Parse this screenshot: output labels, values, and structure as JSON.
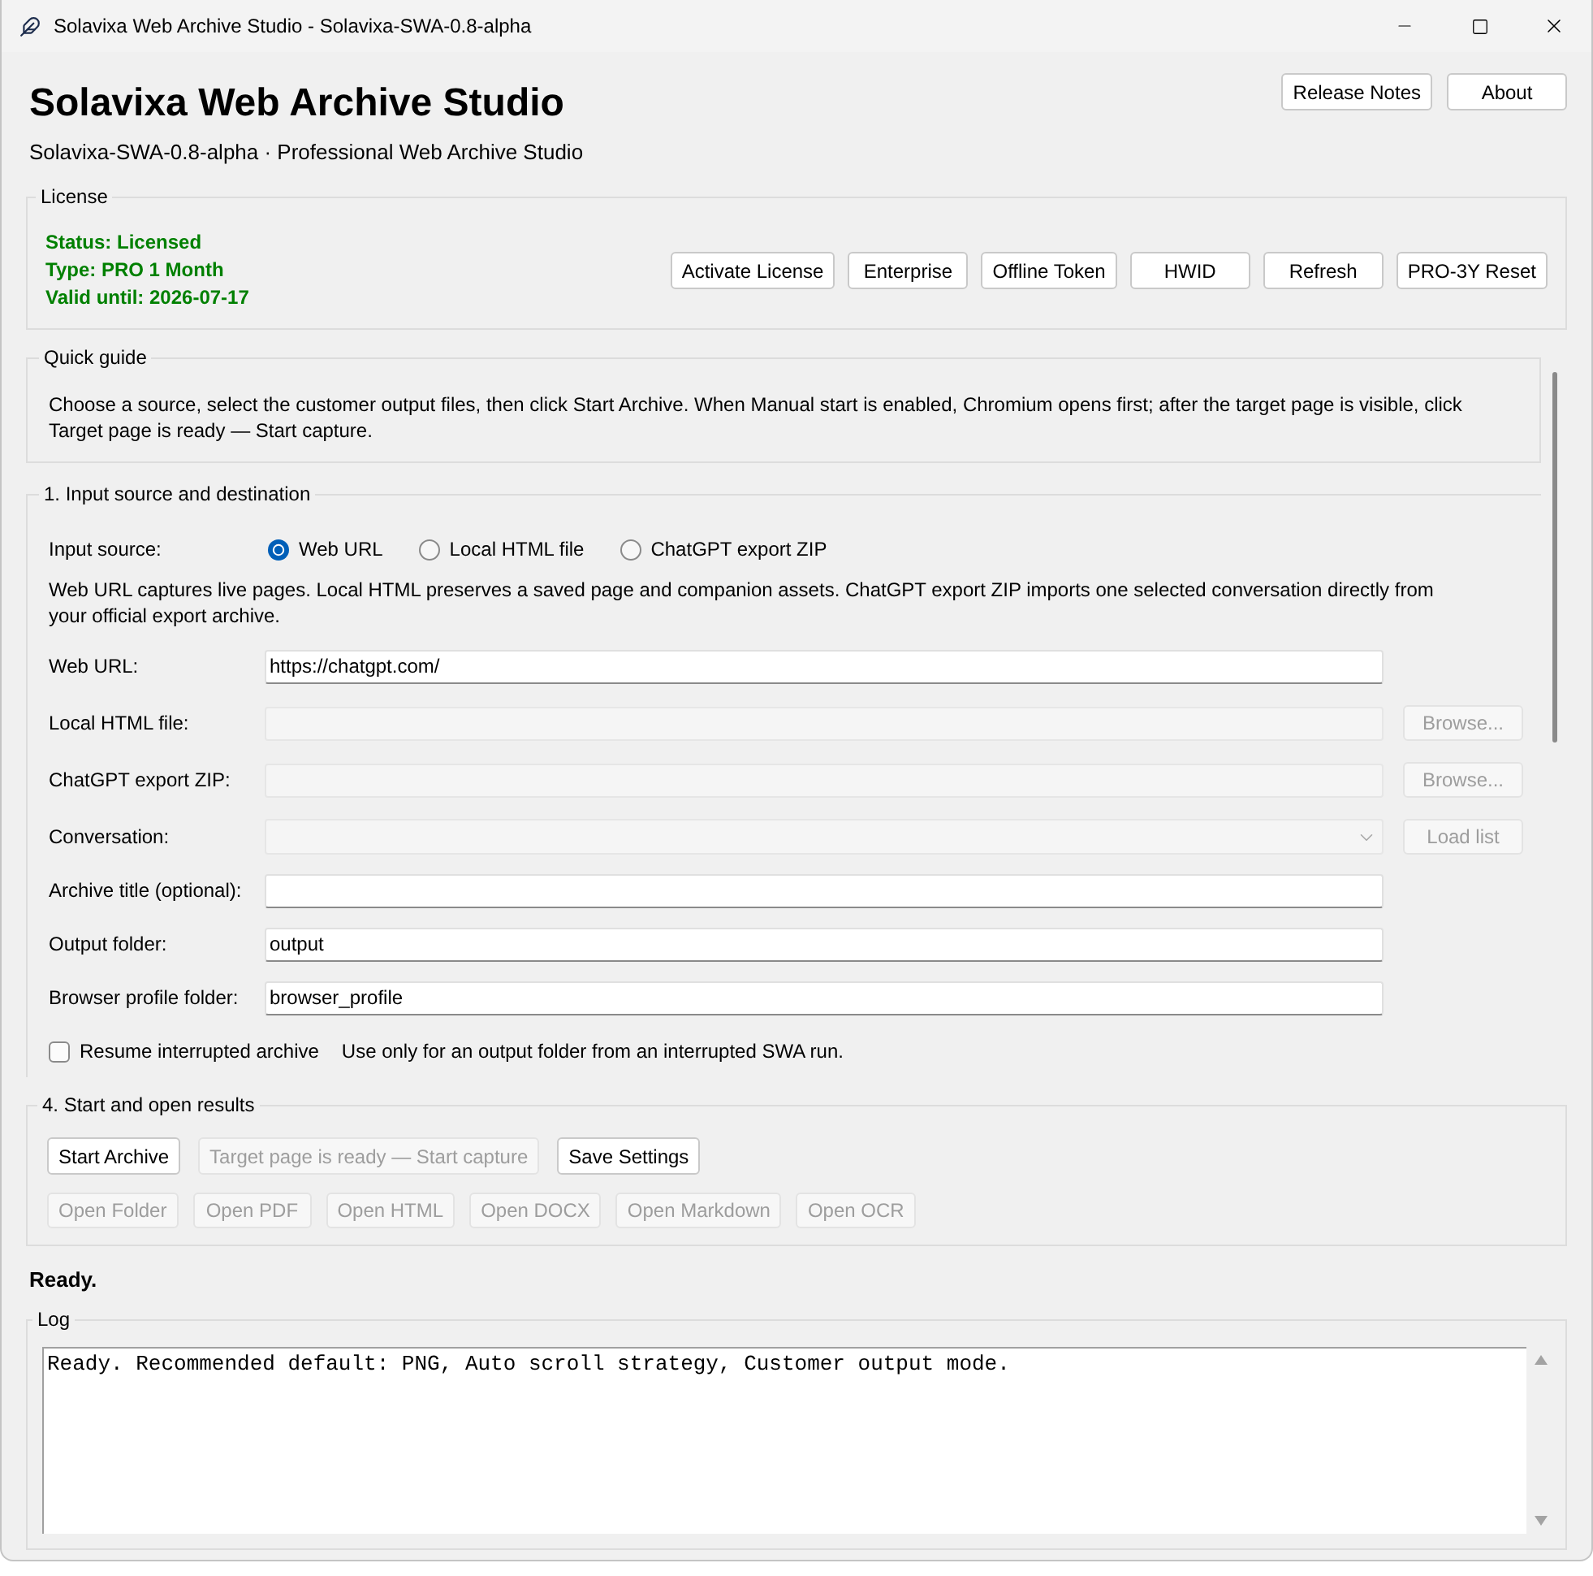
{
  "window": {
    "title": "Solavixa Web Archive Studio - Solavixa-SWA-0.8-alpha"
  },
  "header": {
    "title": "Solavixa Web Archive Studio",
    "subtitle": "Solavixa-SWA-0.8-alpha · Professional Web Archive Studio",
    "buttons": [
      "Release Notes",
      "About"
    ]
  },
  "license": {
    "label": "License",
    "status_lines": [
      "Status: Licensed",
      "Type: PRO 1 Month",
      "Valid until: 2026-07-17"
    ],
    "buttons": [
      "Activate License",
      "Enterprise",
      "Offline Token",
      "HWID",
      "Refresh",
      "PRO-3Y Reset"
    ]
  },
  "quick_guide": {
    "label": "Quick guide",
    "text": "Choose a source, select the customer output files, then click Start Archive. When Manual start is enabled, Chromium opens first; after the target page is visible, click Target page is ready — Start capture."
  },
  "input_section": {
    "label": "1. Input source and destination",
    "source_label": "Input source:",
    "sources": [
      {
        "label": "Web URL",
        "selected": true
      },
      {
        "label": "Local HTML file",
        "selected": false
      },
      {
        "label": "ChatGPT export ZIP",
        "selected": false
      }
    ],
    "description": "Web URL captures live pages. Local HTML preserves a saved page and companion assets. ChatGPT export ZIP imports one selected conversation directly from your official export archive.",
    "fields": [
      {
        "kind": "text",
        "label": "Web URL:",
        "value": "https://chatgpt.com/",
        "disabled": false
      },
      {
        "kind": "file",
        "label": "Local HTML file:",
        "disabled": true,
        "button": {
          "label": "Browse...",
          "disabled": true
        }
      },
      {
        "kind": "file",
        "label": "ChatGPT export ZIP:",
        "disabled": true,
        "button": {
          "label": "Browse...",
          "disabled": true
        }
      },
      {
        "kind": "combo",
        "label": "Conversation:",
        "disabled": true,
        "button": {
          "label": "Load list",
          "disabled": true
        }
      },
      {
        "kind": "text",
        "label": "Archive title (optional):",
        "disabled": false
      },
      {
        "kind": "text",
        "label": "Output folder:",
        "value": "output",
        "disabled": false
      },
      {
        "kind": "text",
        "label": "Browser profile folder:",
        "value": "browser_profile",
        "disabled": false
      }
    ],
    "resume": {
      "label": "Resume interrupted archive",
      "checked": false,
      "note": "Use only for an output folder from an interrupted SWA run."
    }
  },
  "start_section": {
    "label": "4. Start and open results",
    "actions": [
      {
        "label": "Start Archive",
        "disabled": false
      },
      {
        "label": "Target page is ready — Start capture",
        "disabled": true
      },
      {
        "label": "Save Settings",
        "disabled": false
      }
    ],
    "open_buttons": [
      {
        "label": "Open Folder",
        "disabled": true
      },
      {
        "label": "Open PDF",
        "disabled": true
      },
      {
        "label": "Open HTML",
        "disabled": true
      },
      {
        "label": "Open DOCX",
        "disabled": true
      },
      {
        "label": "Open Markdown",
        "disabled": true
      },
      {
        "label": "Open OCR",
        "disabled": true
      }
    ]
  },
  "status": "Ready.",
  "log": {
    "label": "Log",
    "lines": [
      "Ready. Recommended default: PNG, Auto scroll strategy, Customer output mode."
    ]
  }
}
